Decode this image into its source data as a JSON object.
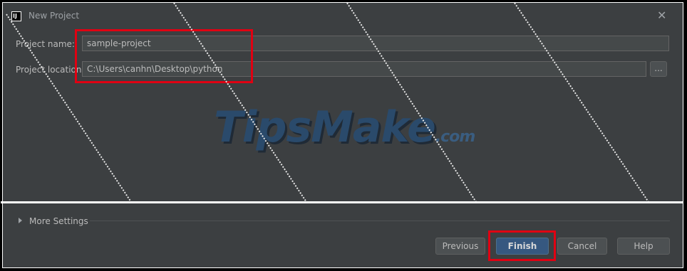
{
  "window": {
    "title": "New Project",
    "app_icon_text": "IJ",
    "close_glyph": "✕"
  },
  "form": {
    "project_name_label": "Project name:",
    "project_name_value": "sample-project",
    "project_location_label": "Project location:",
    "project_location_value": "C:\\Users\\canhn\\Desktop\\python",
    "browse_label": "..."
  },
  "watermark": {
    "text": "TipsMake",
    "suffix": ".com"
  },
  "more_settings": {
    "label": "More Settings",
    "expanded": false
  },
  "buttons": {
    "previous": "Previous",
    "finish": "Finish",
    "cancel": "Cancel",
    "help": "Help"
  },
  "colors": {
    "background": "#3c3f41",
    "field_bg": "#45494a",
    "primary_button": "#365880",
    "highlight_box": "#e00012"
  }
}
